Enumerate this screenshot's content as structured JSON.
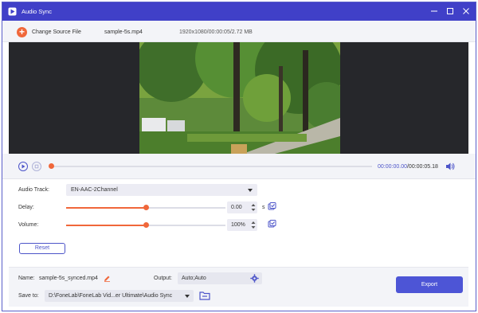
{
  "window": {
    "title": "Audio Sync",
    "accent_color": "#4040c8",
    "controls": [
      "minimize-icon",
      "maximize-icon",
      "close-icon"
    ]
  },
  "toolbar": {
    "change_source_label": "Change Source File",
    "filename": "sample-5s.mp4",
    "file_info": "1920x1080/00:00:05/2.72 MB"
  },
  "player": {
    "current_time": "00:00:00.00",
    "total_time": "/00:00:05.18",
    "progress": 0
  },
  "audio": {
    "track_label": "Audio Track:",
    "track_value": "EN-AAC-2Channel",
    "delay_label": "Delay:",
    "delay_value": "0.00",
    "delay_unit": "s",
    "delay_fraction": 0.5,
    "volume_label": "Volume:",
    "volume_value": "100%",
    "volume_fraction": 0.5,
    "reset_label": "Reset"
  },
  "output": {
    "name_label": "Name:",
    "name_value": "sample-5s_synced.mp4",
    "output_label": "Output:",
    "output_value": "Auto;Auto",
    "saveto_label": "Save to:",
    "saveto_value": "D:\\FoneLab\\FoneLab Vid...er Ultimate\\Audio Sync",
    "export_label": "Export"
  },
  "colors": {
    "orange": "#f0673a",
    "blue": "#4d55d6"
  }
}
